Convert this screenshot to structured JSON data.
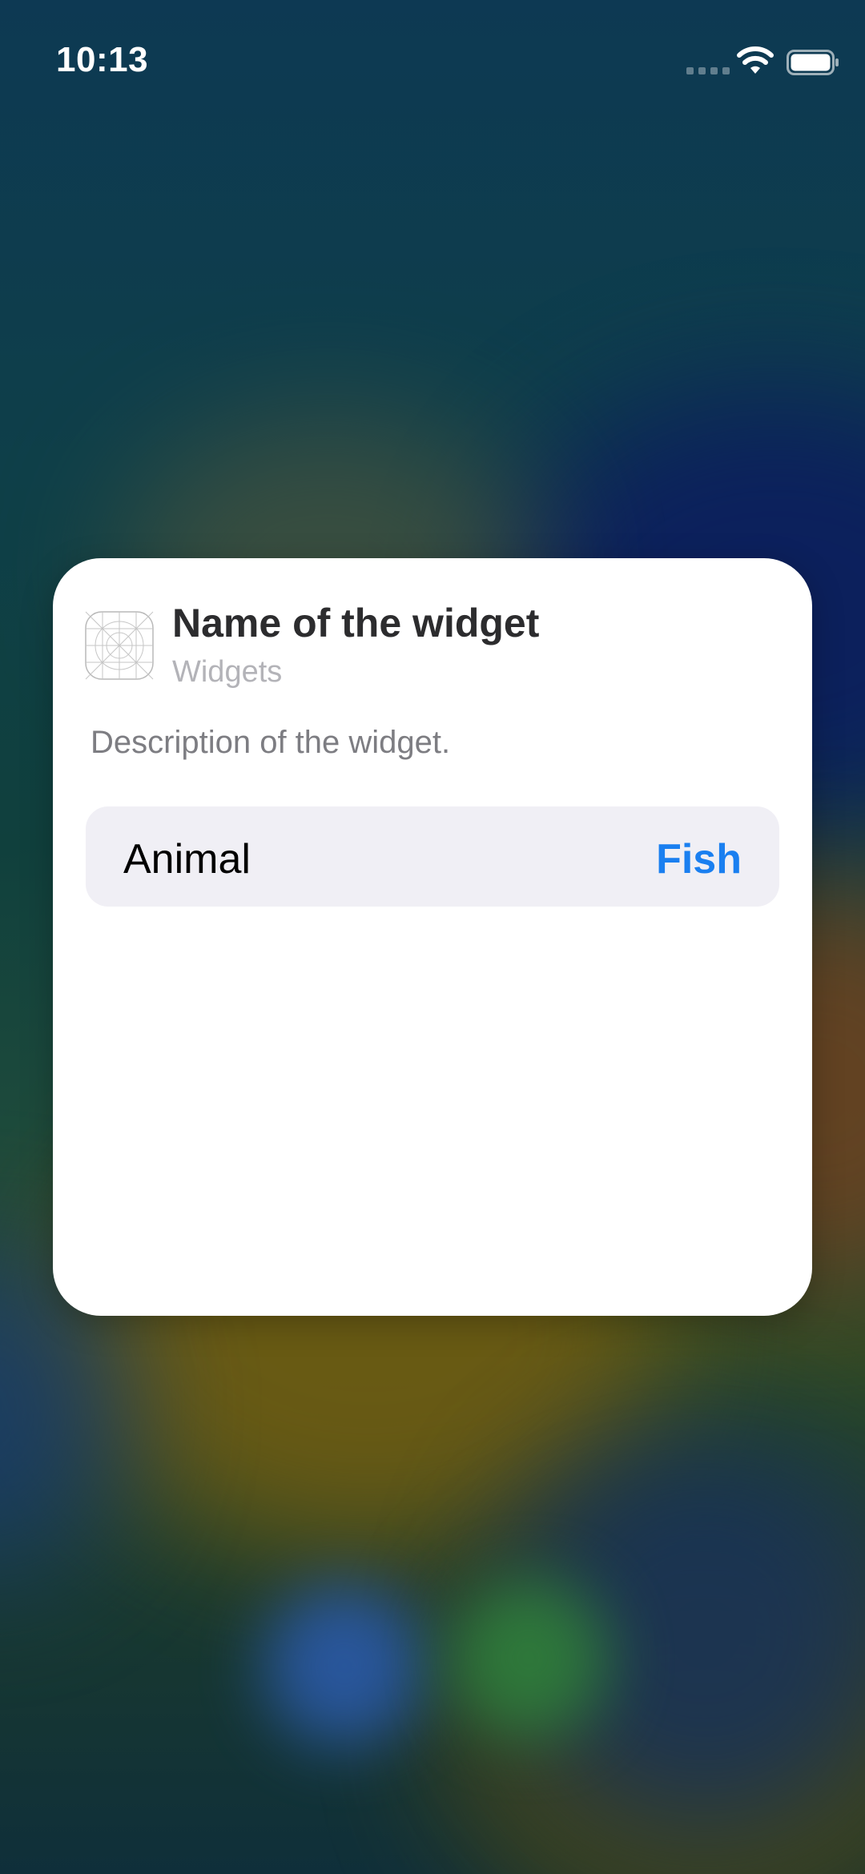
{
  "status_bar": {
    "time": "10:13",
    "icons": [
      "cellular-signal-icon",
      "wifi-icon",
      "battery-icon"
    ]
  },
  "widget_card": {
    "app_icon": "app-icon-placeholder",
    "title": "Name of the widget",
    "subtitle": "Widgets",
    "description": "Description of the widget.",
    "parameter": {
      "label": "Animal",
      "value": "Fish",
      "value_color": "#1a7ff0"
    }
  }
}
